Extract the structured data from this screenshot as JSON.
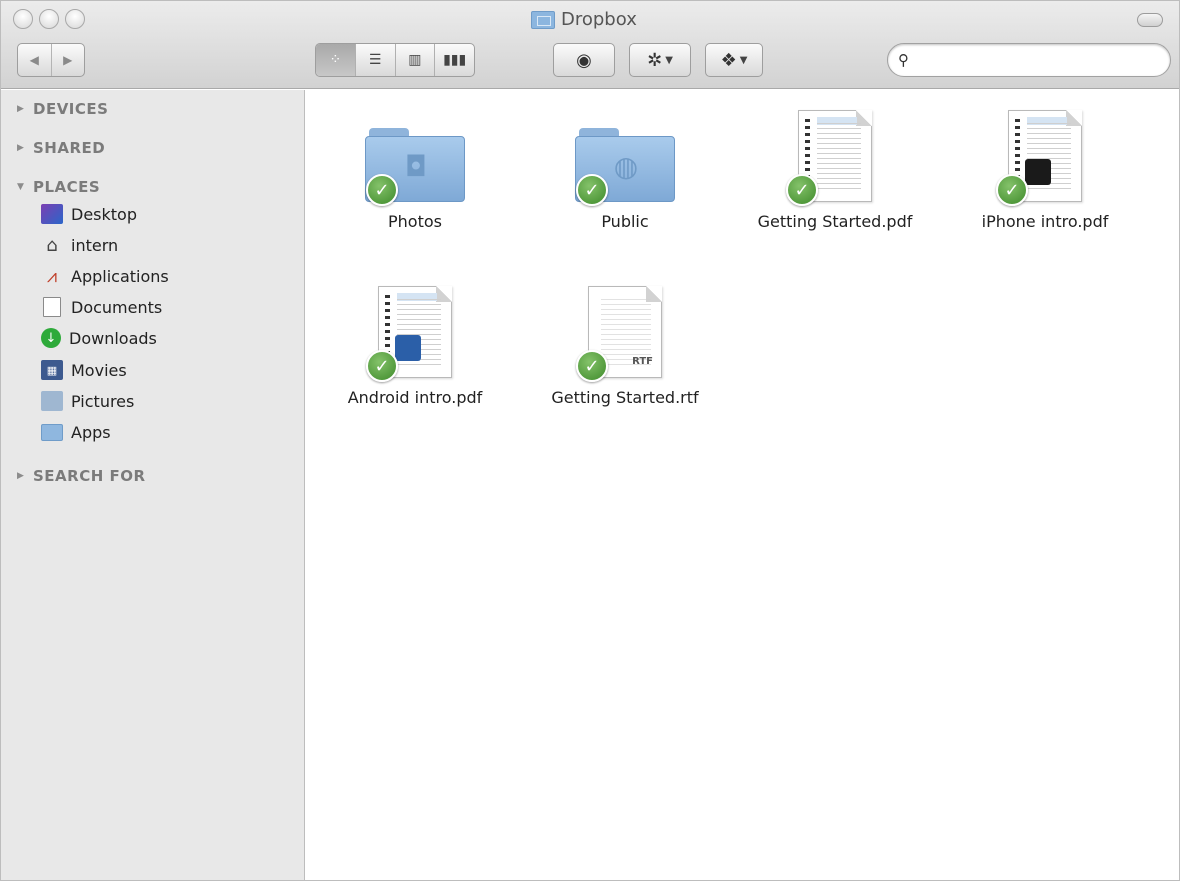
{
  "window": {
    "title": "Dropbox"
  },
  "toolbar": {
    "back_icon": "back-arrow-icon",
    "forward_icon": "forward-arrow-icon",
    "view_modes": [
      "icon-view",
      "list-view",
      "column-view",
      "coverflow-view"
    ],
    "search": {
      "placeholder": "",
      "value": ""
    }
  },
  "sidebar": {
    "sections": [
      {
        "label": "DEVICES",
        "expanded": false
      },
      {
        "label": "SHARED",
        "expanded": false
      },
      {
        "label": "PLACES",
        "expanded": true
      },
      {
        "label": "SEARCH FOR",
        "expanded": false
      }
    ],
    "places": [
      {
        "label": "Desktop",
        "icon": "desktop-icon"
      },
      {
        "label": "intern",
        "icon": "home-icon"
      },
      {
        "label": "Applications",
        "icon": "applications-icon"
      },
      {
        "label": "Documents",
        "icon": "documents-icon"
      },
      {
        "label": "Downloads",
        "icon": "downloads-icon"
      },
      {
        "label": "Movies",
        "icon": "movies-icon"
      },
      {
        "label": "Pictures",
        "icon": "pictures-icon"
      },
      {
        "label": "Apps",
        "icon": "folder-icon"
      }
    ]
  },
  "files": [
    {
      "name": "Photos",
      "kind": "folder",
      "synced": true
    },
    {
      "name": "Public",
      "kind": "folder",
      "synced": true
    },
    {
      "name": "Getting Started.pdf",
      "kind": "pdf",
      "synced": true
    },
    {
      "name": "iPhone intro.pdf",
      "kind": "pdf",
      "synced": true
    },
    {
      "name": "Android intro.pdf",
      "kind": "pdf",
      "synced": true
    },
    {
      "name": "Getting Started.rtf",
      "kind": "rtf",
      "badge": "RTF",
      "synced": true
    }
  ]
}
